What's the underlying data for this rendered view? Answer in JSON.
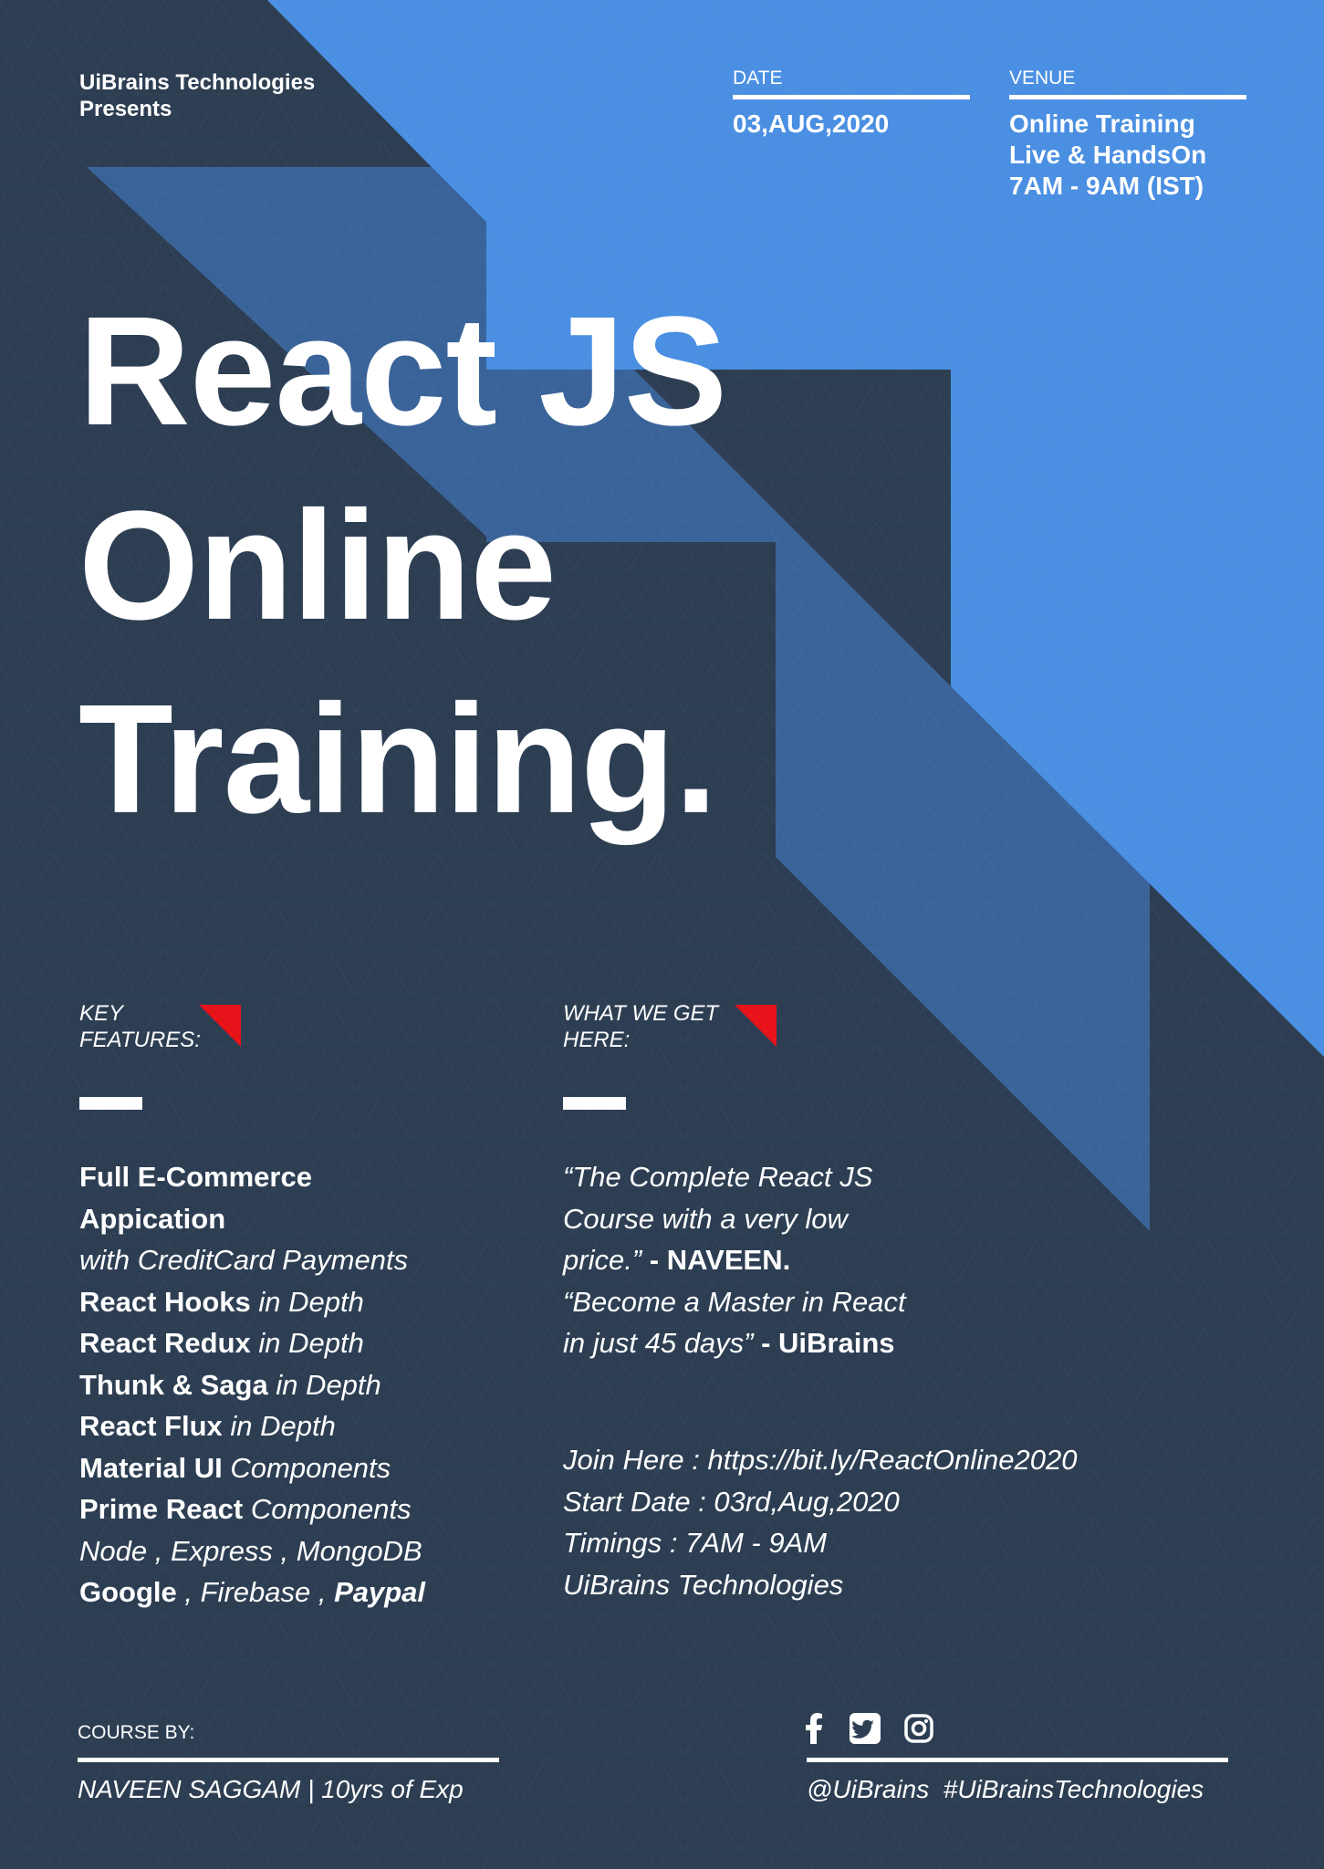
{
  "colors": {
    "background": "#2d3e53",
    "accent_light_blue": "#4a8fe2",
    "accent_mid_blue": "#3a6499",
    "accent_red": "#e8121b",
    "text": "#ffffff"
  },
  "header": {
    "presenter_line1": "UiBrains Technologies",
    "presenter_line2": "Presents",
    "date_label": "DATE",
    "date_value": "03,AUG,2020",
    "venue_label": "VENUE",
    "venue_lines": [
      "Online Training",
      "Live & HandsOn",
      "7AM - 9AM (IST)"
    ]
  },
  "title": {
    "lines": [
      "React JS",
      "Online",
      "Training."
    ]
  },
  "key_features": {
    "heading_line1": "KEY",
    "heading_line2": "FEATURES:",
    "items": [
      [
        {
          "t": "Full E-Commerce",
          "s": "b"
        }
      ],
      [
        {
          "t": "Appication",
          "s": "b"
        }
      ],
      [
        {
          "t": "with CreditCard Payments",
          "s": "i"
        }
      ],
      [
        {
          "t": "React Hooks",
          "s": "b"
        },
        {
          "t": " in Depth",
          "s": "i"
        }
      ],
      [
        {
          "t": "React Redux",
          "s": "b"
        },
        {
          "t": " in Depth",
          "s": "i"
        }
      ],
      [
        {
          "t": "Thunk & Saga",
          "s": "b"
        },
        {
          "t": " in Depth",
          "s": "i"
        }
      ],
      [
        {
          "t": "React Flux",
          "s": "b"
        },
        {
          "t": " in Depth",
          "s": "i"
        }
      ],
      [
        {
          "t": "Material UI",
          "s": "b"
        },
        {
          "t": " Components",
          "s": "i"
        }
      ],
      [
        {
          "t": "Prime React",
          "s": "b"
        },
        {
          "t": " Components",
          "s": "i"
        }
      ],
      [
        {
          "t": "Node , Express , MongoDB",
          "s": "i"
        }
      ],
      [
        {
          "t": "Google",
          "s": "b"
        },
        {
          "t": " , Firebase , ",
          "s": "i"
        },
        {
          "t": "Paypal",
          "s": "bi"
        }
      ]
    ]
  },
  "what_we_get": {
    "heading_line1": "WHAT WE GET",
    "heading_line2": "HERE:",
    "quote_lines": [
      [
        {
          "t": "“The Complete React JS",
          "s": "i"
        }
      ],
      [
        {
          "t": "Course with a very low",
          "s": "i"
        }
      ],
      [
        {
          "t": "price.”",
          "s": "i"
        },
        {
          "t": " - NAVEEN.",
          "s": "b"
        }
      ],
      [
        {
          "t": "“Become a Master in React",
          "s": "i"
        }
      ],
      [
        {
          "t": "in just 45 days”",
          "s": "i"
        },
        {
          "t": " - UiBrains",
          "s": "b"
        }
      ]
    ],
    "join_lines": [
      "Join Here : https://bit.ly/ReactOnline2020",
      "Start Date : 03rd,Aug,2020",
      "Timings : 7AM - 9AM",
      "UiBrains Technologies"
    ]
  },
  "footer": {
    "course_by_label": "COURSE BY:",
    "instructor": "NAVEEN SAGGAM | 10yrs of Exp",
    "social_icons": [
      "facebook-icon",
      "twitter-icon",
      "instagram-icon"
    ],
    "handles": "@UiBrains  #UiBrainsTechnologies"
  }
}
